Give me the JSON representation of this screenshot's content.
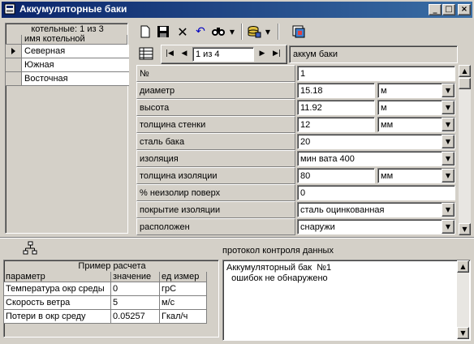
{
  "window": {
    "title": "Аккумуляторные баки"
  },
  "left_grid": {
    "caption": "котельные: 1 из 3",
    "column_header": "имя котельной",
    "rows": [
      "Северная",
      "Южная",
      "Восточная"
    ]
  },
  "toolbar": {
    "icons": [
      "new-icon",
      "save-icon",
      "delete-icon",
      "undo-icon",
      "find-icon",
      "database-icon",
      "export-icon"
    ]
  },
  "navigator": {
    "position": "1 из 4",
    "record_label": "аккум баки"
  },
  "properties": [
    {
      "label": "№",
      "value": "1",
      "unit": ""
    },
    {
      "label": "диаметр",
      "value": "15.18",
      "unit": "м"
    },
    {
      "label": "высота",
      "value": "11.92",
      "unit": "м"
    },
    {
      "label": "толщина стенки",
      "value": "12",
      "unit": "мм"
    },
    {
      "label": "сталь бака",
      "value": "20",
      "unit": ""
    },
    {
      "label": "изоляция",
      "value": "мин вата 400",
      "unit": ""
    },
    {
      "label": "толщина изоляции",
      "value": "80",
      "unit": "мм"
    },
    {
      "label": "% неизолир поверх",
      "value": "0",
      "unit": ""
    },
    {
      "label": "покрытие изоляции",
      "value": "сталь оцинкованная",
      "unit": ""
    },
    {
      "label": "расположен",
      "value": "снаружи",
      "unit": ""
    }
  ],
  "protocol": {
    "title": "протокол контроля данных",
    "lines": [
      "Аккумуляторный бак  №1",
      "  ошибок не обнаружено"
    ]
  },
  "example": {
    "caption": "Пример расчета",
    "headers": [
      "параметр",
      "значение",
      "ед измер"
    ],
    "rows": [
      [
        "Температура окр среды",
        "0",
        "грС"
      ],
      [
        "Скорость ветра",
        "5",
        "м/с"
      ],
      [
        "Потери в окр среду",
        "0.05257",
        "Гкал/ч"
      ]
    ]
  }
}
